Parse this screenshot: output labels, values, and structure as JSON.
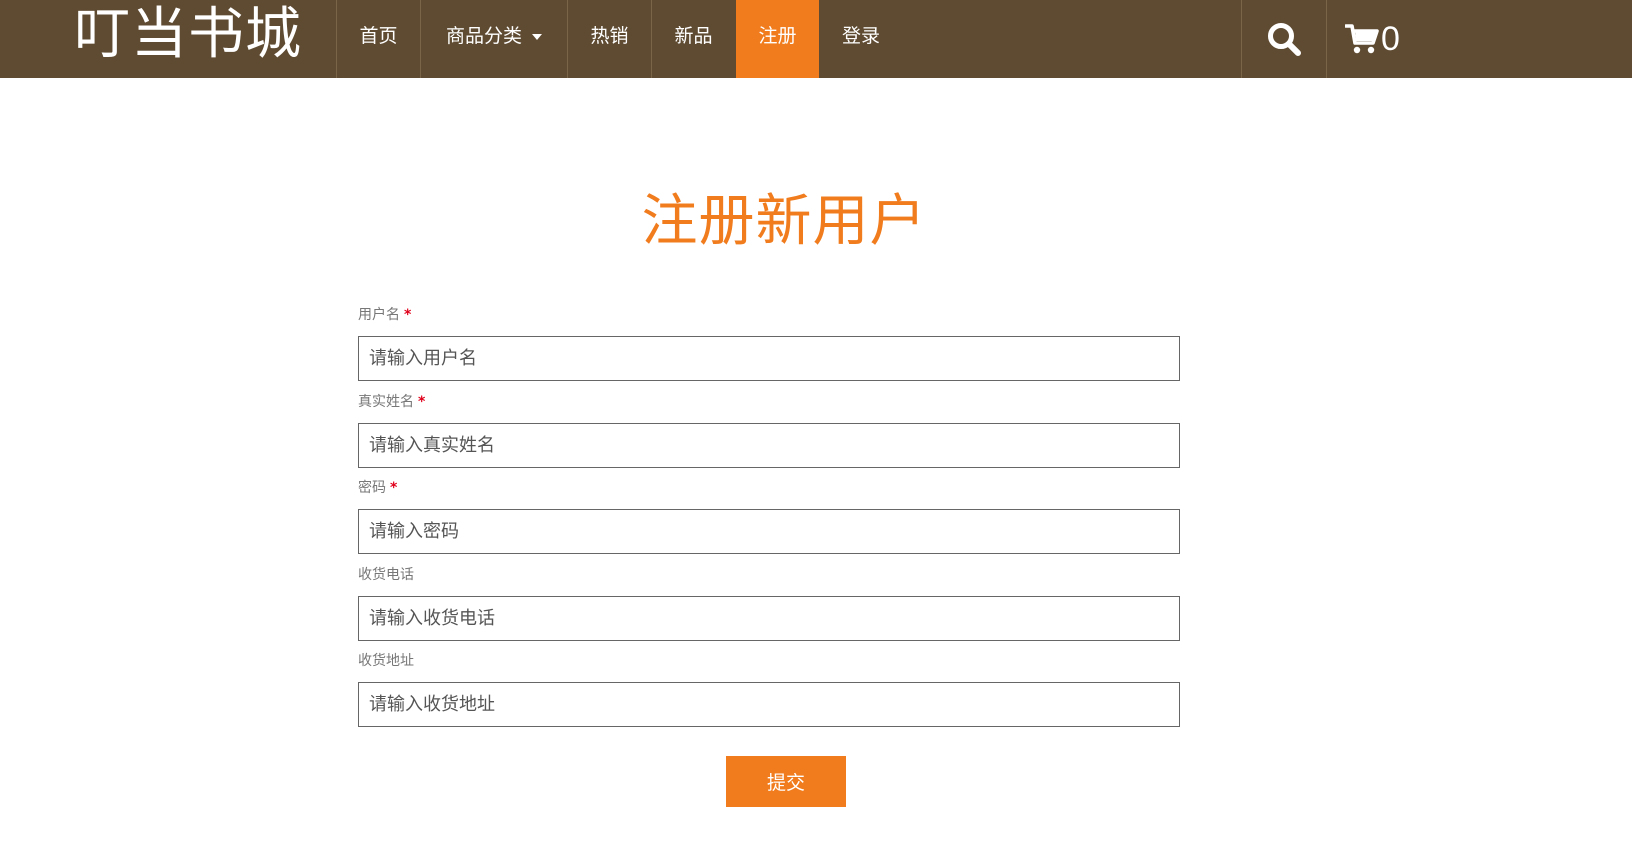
{
  "brand": {
    "title": "叮当书城"
  },
  "nav": {
    "items": [
      {
        "label": "首页"
      },
      {
        "label": "商品分类"
      },
      {
        "label": "热销"
      },
      {
        "label": "新品"
      },
      {
        "label": "注册",
        "active": true
      },
      {
        "label": "登录"
      }
    ]
  },
  "cart": {
    "count": "0"
  },
  "page": {
    "title": "注册新用户"
  },
  "form": {
    "required_mark": "*",
    "fields": [
      {
        "label": "用户名",
        "placeholder": "请输入用户名",
        "value": "",
        "required": true
      },
      {
        "label": "真实姓名",
        "placeholder": "请输入真实姓名",
        "value": "",
        "required": true
      },
      {
        "label": "密码",
        "placeholder": "请输入密码",
        "value": "",
        "required": true
      },
      {
        "label": "收货电话",
        "placeholder": "请输入收货电话",
        "value": "",
        "required": false
      },
      {
        "label": "收货地址",
        "placeholder": "请输入收货地址",
        "value": "",
        "required": false
      }
    ],
    "submit_label": "提交"
  },
  "colors": {
    "navbar_bg": "#5f4b32",
    "accent": "#f07c1e",
    "required": "#e0001a"
  },
  "icons": {
    "search": "search-icon",
    "cart": "cart-icon",
    "dropdown": "caret-down-icon"
  }
}
